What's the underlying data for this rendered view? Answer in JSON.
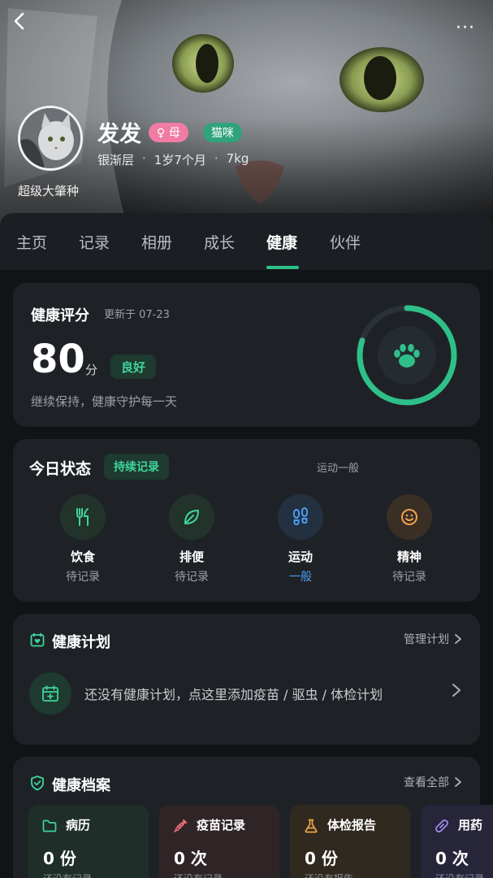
{
  "header": {
    "back_icon": "chevron-left-icon",
    "more_icon": "more-dots-icon",
    "more_label": "···"
  },
  "pet": {
    "name": "发发",
    "gender_tag": "♀ 母",
    "species_tag": "猫咪",
    "breed": "银渐层",
    "age": "1岁7个月",
    "weight": "7kg",
    "owner_title": "超级大肇种"
  },
  "tabs": [
    {
      "label": "主页"
    },
    {
      "label": "记录"
    },
    {
      "label": "相册"
    },
    {
      "label": "成长"
    },
    {
      "label": "健康",
      "active": true
    },
    {
      "label": "伙伴"
    }
  ],
  "health_score": {
    "title": "健康评分",
    "updated": "更新于 07-23",
    "score": "80",
    "unit": "分",
    "level": "良好",
    "tip": "继续保持，健康守护每一天",
    "progress": 0.8,
    "icon": "paw-icon"
  },
  "today_status": {
    "title": "今日状态",
    "streak_badge": "持续记录",
    "exercise_note": "运动一般",
    "items": [
      {
        "label": "饮食",
        "value": "待记录",
        "icon": "utensils-icon"
      },
      {
        "label": "排便",
        "value": "待记录",
        "icon": "leaf-icon"
      },
      {
        "label": "运动",
        "value": "一般",
        "icon": "footprints-icon"
      },
      {
        "label": "精神",
        "value": "待记录",
        "icon": "smile-icon"
      }
    ]
  },
  "health_plan": {
    "title": "健康计划",
    "manage_label": "管理计划",
    "empty_text": "还没有健康计划，点这里添加疫苗 / 驱虫 / 体检计划"
  },
  "health_records": {
    "title": "健康档案",
    "view_all_label": "查看全部",
    "items": [
      {
        "name": "病历",
        "count": "0 份",
        "note": "还没有记录",
        "icon": "folder-icon"
      },
      {
        "name": "疫苗记录",
        "count": "0 次",
        "note": "还没有记录",
        "icon": "syringe-icon"
      },
      {
        "name": "体检报告",
        "count": "0 份",
        "note": "还没有报告",
        "icon": "flask-icon"
      },
      {
        "name": "用药",
        "count": "0 次",
        "note": "还没有记录",
        "icon": "pill-icon"
      }
    ]
  },
  "colors": {
    "accent_green": "#2fc08a",
    "background": "#111417",
    "card": "#1e2226",
    "gender_pink": "#f07ca3",
    "species_green": "#2fa37c",
    "exercise_blue": "#4a9df2"
  }
}
